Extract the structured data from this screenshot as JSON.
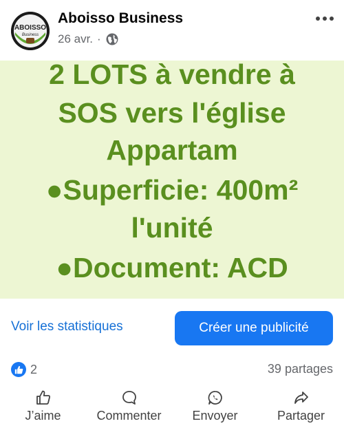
{
  "post": {
    "page_name": "Aboisso Business",
    "date": "26 avr.",
    "separator": "·",
    "privacy_icon": "globe-icon",
    "more_icon": "more-horizontal-icon",
    "avatar_logo_text": "ABOISSO",
    "avatar_logo_subtext": "Business"
  },
  "image": {
    "lines": [
      "2 LOTS à vendre à",
      "SOS vers l'église",
      "Appartam",
      "●Superficie: 400m²",
      "l'unité",
      "●Document: ACD"
    ],
    "background": "#edf6d3",
    "text_color": "#5a8f1f"
  },
  "insights": {
    "stats_label": "Voir les statistiques",
    "promote_label": "Créer une publicité"
  },
  "engagement": {
    "like_count": "2",
    "shares_label": "39 partages"
  },
  "actions": [
    {
      "label": "J’aime",
      "icon": "thumbs-up-icon"
    },
    {
      "label": "Commenter",
      "icon": "comment-icon"
    },
    {
      "label": "Envoyer",
      "icon": "whatsapp-icon"
    },
    {
      "label": "Partager",
      "icon": "share-icon"
    }
  ],
  "colors": {
    "accent": "#1877f2",
    "link": "#1570d6",
    "muted": "#65676b"
  }
}
